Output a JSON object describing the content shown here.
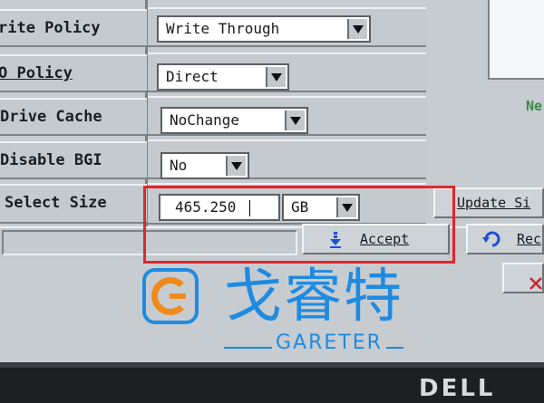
{
  "form": {
    "write_policy_label": "rite Policy",
    "write_policy_value": "Write Through",
    "io_policy_label": "O Policy",
    "io_policy_value": "Direct",
    "drive_cache_label": "Drive Cache",
    "drive_cache_value": "NoChange",
    "disable_bgi_label": "Disable BGI",
    "disable_bgi_value": "No",
    "select_size_label": "Select Size",
    "size_value": "465.250",
    "size_unit": "GB"
  },
  "buttons": {
    "update_size": "Update Si",
    "accept": "Accept",
    "reclaim": "Rec"
  },
  "right_panel": {
    "partial_text": "Ne"
  },
  "watermark": {
    "chinese": "戈睿特",
    "latin": "GARETER"
  },
  "bezel": {
    "brand": "DELL"
  },
  "colors": {
    "highlight": "#e1262b",
    "watermark_blue": "#1f8be0",
    "watermark_orange": "#f08a1c"
  }
}
